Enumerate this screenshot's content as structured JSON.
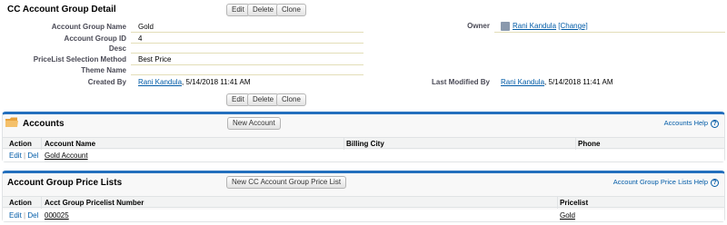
{
  "detail": {
    "title": "CC Account Group Detail",
    "buttons": {
      "edit": "Edit",
      "delete": "Delete",
      "clone": "Clone"
    },
    "fields": {
      "account_group_name": {
        "label": "Account Group Name",
        "value": "Gold"
      },
      "account_group_id": {
        "label": "Account Group ID",
        "value": "4"
      },
      "desc": {
        "label": "Desc",
        "value": ""
      },
      "pricelist_method": {
        "label": "PriceList Selection Method",
        "value": "Best Price"
      },
      "theme_name": {
        "label": "Theme Name",
        "value": ""
      },
      "created_by": {
        "label": "Created By",
        "user": "Rani Kandula",
        "date": ", 5/14/2018 11:41 AM"
      },
      "owner": {
        "label": "Owner",
        "user": "Rani Kandula",
        "change": "[Change]"
      },
      "last_modified_by": {
        "label": "Last Modified By",
        "user": "Rani Kandula",
        "date": ", 5/14/2018 11:41 AM"
      }
    }
  },
  "accounts": {
    "title": "Accounts",
    "new_button": "New Account",
    "help": "Accounts Help",
    "help_icon": "?",
    "columns": [
      "Action",
      "Account Name",
      "Billing City",
      "Phone"
    ],
    "rows": [
      {
        "edit": "Edit",
        "sep": "|",
        "del": "Del",
        "name": "Gold Account",
        "city": "",
        "phone": ""
      }
    ]
  },
  "price_lists": {
    "title": "Account Group Price Lists",
    "new_button": "New CC Account Group Price List",
    "help": "Account Group Price Lists Help",
    "help_icon": "?",
    "columns": [
      "Action",
      "Acct Group Pricelist Number",
      "Pricelist"
    ],
    "rows": [
      {
        "edit": "Edit",
        "sep": "|",
        "del": "Del",
        "number": "000025",
        "pricelist": "Gold"
      }
    ]
  },
  "colors": {
    "accent": "#236fbd",
    "link": "#015ba7",
    "folder": "#e9a23b"
  }
}
